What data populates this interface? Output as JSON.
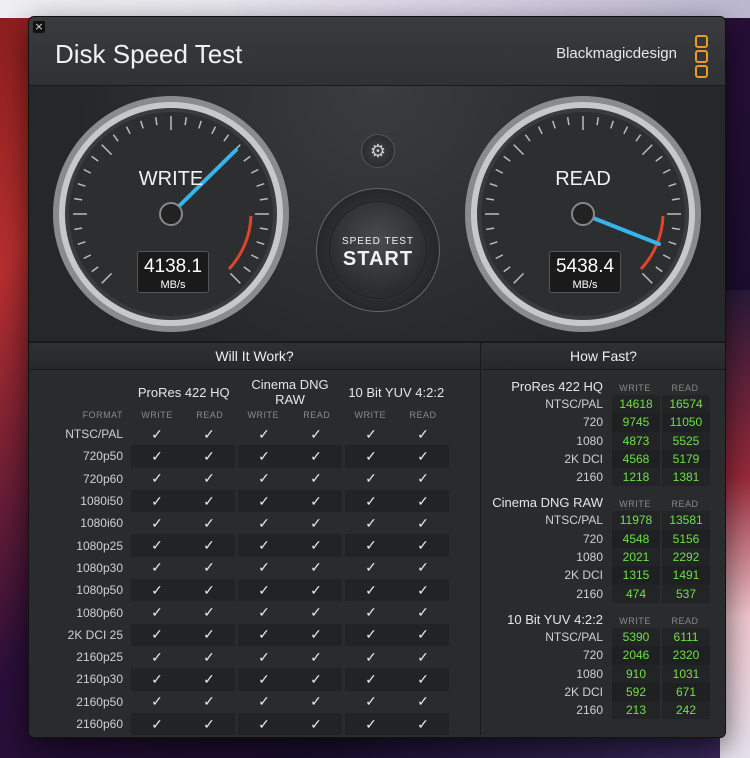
{
  "app": {
    "title": "Disk Speed Test",
    "brand": "Blackmagicdesign",
    "close": "×"
  },
  "gauges": {
    "write": {
      "label": "WRITE",
      "value": "4138.1",
      "unit": "MB/s"
    },
    "read": {
      "label": "READ",
      "value": "5438.4",
      "unit": "MB/s"
    }
  },
  "start": {
    "small": "SPEED TEST",
    "big": "START"
  },
  "settings_icon": "gear-icon",
  "will_it_work": {
    "title": "Will It Work?",
    "groups": [
      "ProRes 422 HQ",
      "Cinema DNG RAW",
      "10 Bit YUV 4:2:2"
    ],
    "format_header": "FORMAT",
    "write_header": "WRITE",
    "read_header": "READ",
    "check": "✓",
    "formats": [
      "NTSC/PAL",
      "720p50",
      "720p60",
      "1080i50",
      "1080i60",
      "1080p25",
      "1080p30",
      "1080p50",
      "1080p60",
      "2K DCI 25",
      "2160p25",
      "2160p30",
      "2160p50",
      "2160p60"
    ]
  },
  "how_fast": {
    "title": "How Fast?",
    "write_header": "WRITE",
    "read_header": "READ",
    "groups": [
      {
        "name": "ProRes 422 HQ",
        "rows": [
          {
            "fmt": "NTSC/PAL",
            "w": "14618",
            "r": "16574"
          },
          {
            "fmt": "720",
            "w": "9745",
            "r": "11050"
          },
          {
            "fmt": "1080",
            "w": "4873",
            "r": "5525"
          },
          {
            "fmt": "2K DCI",
            "w": "4568",
            "r": "5179"
          },
          {
            "fmt": "2160",
            "w": "1218",
            "r": "1381"
          }
        ]
      },
      {
        "name": "Cinema DNG RAW",
        "rows": [
          {
            "fmt": "NTSC/PAL",
            "w": "11978",
            "r": "13581"
          },
          {
            "fmt": "720",
            "w": "4548",
            "r": "5156"
          },
          {
            "fmt": "1080",
            "w": "2021",
            "r": "2292"
          },
          {
            "fmt": "2K DCI",
            "w": "1315",
            "r": "1491"
          },
          {
            "fmt": "2160",
            "w": "474",
            "r": "537"
          }
        ]
      },
      {
        "name": "10 Bit YUV 4:2:2",
        "rows": [
          {
            "fmt": "NTSC/PAL",
            "w": "5390",
            "r": "6111"
          },
          {
            "fmt": "720",
            "w": "2046",
            "r": "2320"
          },
          {
            "fmt": "1080",
            "w": "910",
            "r": "1031"
          },
          {
            "fmt": "2K DCI",
            "w": "592",
            "r": "671"
          },
          {
            "fmt": "2160",
            "w": "213",
            "r": "242"
          }
        ]
      }
    ]
  }
}
